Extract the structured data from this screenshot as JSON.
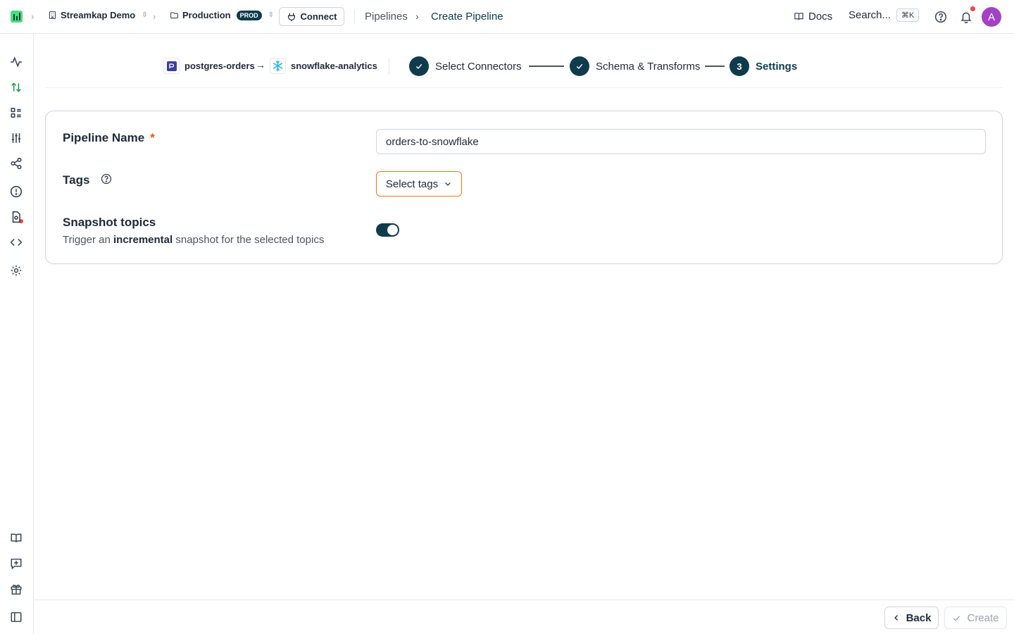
{
  "topbar": {
    "workspace": "Streamkap Demo",
    "environment": "Production",
    "environment_badge": "PROD",
    "connect_label": "Connect",
    "breadcrumb_pipelines": "Pipelines",
    "breadcrumb_current": "Create Pipeline",
    "docs_label": "Docs",
    "search_label": "Search...",
    "search_shortcut": "⌘K",
    "avatar_initial": "A"
  },
  "stepper": {
    "source_name": "postgres-orders",
    "arrow": "→",
    "destination_name": "snowflake-analytics",
    "steps": [
      {
        "label": "Select Connectors",
        "status": "complete"
      },
      {
        "label": "Schema & Transforms",
        "status": "complete"
      },
      {
        "label": "Settings",
        "status": "current",
        "number": "3"
      }
    ]
  },
  "form": {
    "pipeline_name_label": "Pipeline Name",
    "required_mark": "*",
    "pipeline_name_value": "orders-to-snowflake",
    "tags_label": "Tags",
    "tags_placeholder": "Select tags",
    "snapshot_label": "Snapshot topics",
    "snapshot_desc_before": "Trigger an",
    "snapshot_desc_bold": "incremental",
    "snapshot_desc_after": "snapshot for the selected topics",
    "snapshot_enabled": true
  },
  "footer": {
    "back_label": "Back",
    "create_label": "Create"
  },
  "colors": {
    "primary": "#0f3b4c",
    "accent_green": "#4ade80",
    "focus_orange": "#f97316",
    "avatar": "#a142c4",
    "notification": "#ef4444"
  }
}
